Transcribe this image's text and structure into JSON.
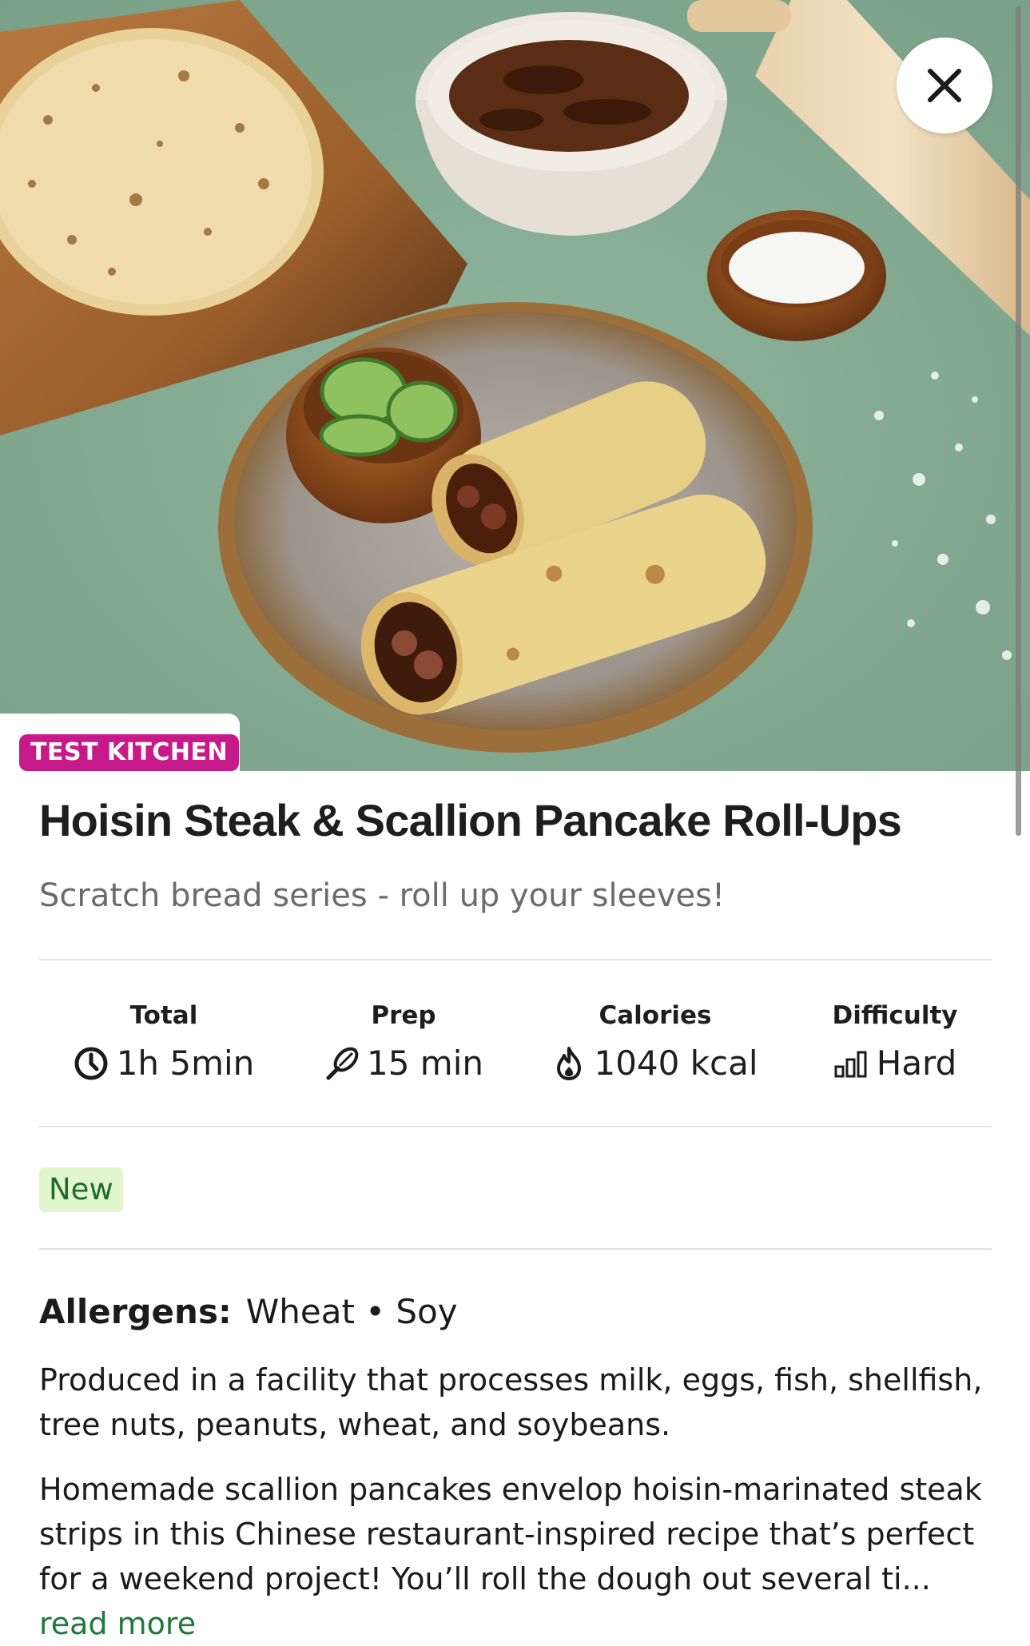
{
  "hero": {
    "image": "Hoisin steak scallion pancake roll-ups on a ceramic plate with cucumbers, steak bowl, salt bowl, scallion pancake on board and rolling pin",
    "close_icon": "close-icon"
  },
  "badge": {
    "label": "TEST KITCHEN",
    "color": "#c8198a"
  },
  "recipe": {
    "title": "Hoisin Steak & Scallion Pancake Roll-Ups",
    "subtitle": "Scratch bread series - roll up your sleeves!"
  },
  "stats": [
    {
      "label": "Total",
      "value": "1h 5min",
      "icon": "clock-icon"
    },
    {
      "label": "Prep",
      "value": "15 min",
      "icon": "whisk-icon"
    },
    {
      "label": "Calories",
      "value": "1040 kcal",
      "icon": "flame-icon"
    },
    {
      "label": "Difficulty",
      "value": "Hard",
      "icon": "difficulty-bars-icon"
    }
  ],
  "tag": {
    "label": "New",
    "color": "#e1f5cf"
  },
  "allergens": {
    "label": "Allergens:",
    "value": "Wheat • Soy",
    "facility_note": "Produced in a facility that processes milk, eggs, fish, shellfish, tree nuts, peanuts, wheat, and soybeans."
  },
  "description": {
    "text": "Homemade scallion pancakes envelop hoisin-marinated steak strips in this Chinese restaurant-inspired recipe that’s perfect for a weekend project! You’ll roll the dough out several ti...",
    "read_more": "read more",
    "link_color": "#1e7a3a"
  }
}
